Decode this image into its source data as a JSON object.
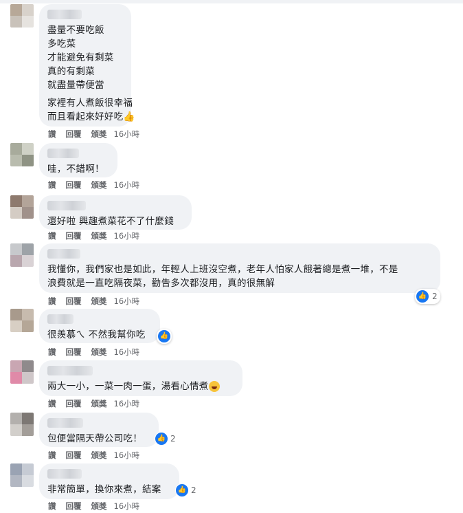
{
  "actions": {
    "like": "讚",
    "reply": "回覆",
    "award": "頒獎"
  },
  "comments": [
    {
      "lines": [
        "盡量不要吃飯",
        "多吃菜",
        "才能避免有剩菜",
        "真的有剩菜",
        "就盡量帶便當"
      ],
      "lines2": [
        "家裡有人煮飯很幸福",
        "而且看起來好好吃"
      ],
      "emoji": "thumbs-up-emoji",
      "time": "16小時"
    },
    {
      "lines": [
        "哇，不錯啊！"
      ],
      "time": "16小時"
    },
    {
      "lines": [
        "還好啦 興趣煮菜花不了什麼錢"
      ],
      "time": "16小時"
    },
    {
      "lines": [
        "我懂你，我們家也是如此，年輕人上班沒空煮，老年人怕家人餓著總是煮一堆，不是",
        "浪費就是一直吃隔夜菜，勸告多次都沒用，真的很無解"
      ],
      "reaction_count": "2",
      "time": "16小時"
    },
    {
      "lines": [
        "很羨慕ㄟ 不然我幫你吃"
      ],
      "reaction": "like-icon",
      "time": "16小時"
    },
    {
      "lines": [
        "兩大一小，一菜一肉一蛋，湯看心情煮"
      ],
      "reaction": "haha-icon",
      "time": "16小時"
    },
    {
      "lines": [
        "包便當隔天帶公司吃！"
      ],
      "reaction_count": "2",
      "time": "16小時"
    },
    {
      "lines": [
        "非常簡單，換你來煮，結案"
      ],
      "reaction_count": "2",
      "time": "16小時"
    }
  ],
  "colors": {
    "bubble": "#f0f2f5",
    "like_blue": "#1877f2",
    "meta_gray": "#65676b"
  }
}
